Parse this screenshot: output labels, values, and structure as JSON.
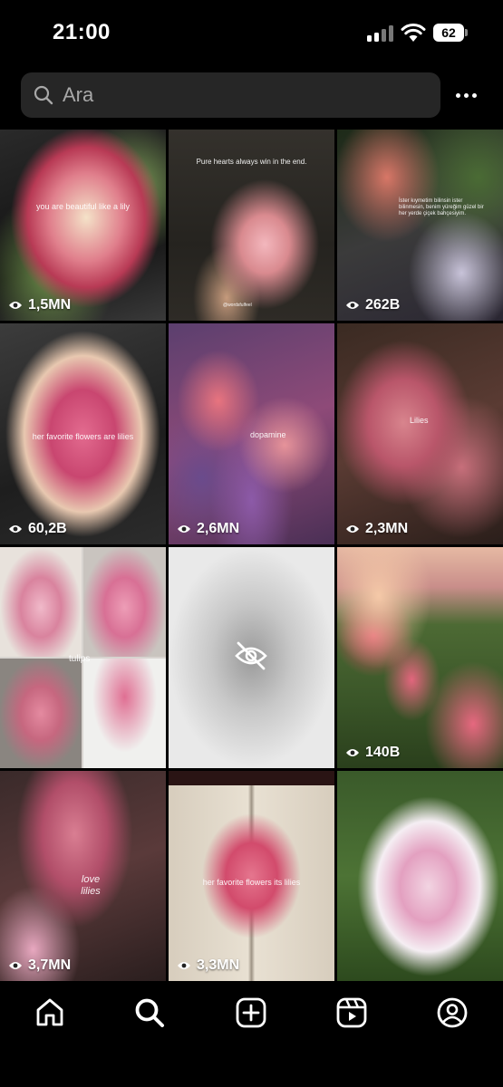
{
  "status_bar": {
    "time": "21:00",
    "battery": "62"
  },
  "search": {
    "placeholder": "Ara"
  },
  "tiles": [
    {
      "caption": "you are beautiful like a lily",
      "views": "1,5MN"
    },
    {
      "caption": "Pure hearts always win in the end.",
      "credit": "@wordsfulfeel",
      "views": ""
    },
    {
      "caption": "İster kıymetim bilinsin ister bilinmesin, benim yüreğim güzel bir her yerde çiçek bahçesiyim.",
      "views": "262B"
    },
    {
      "caption": "her favorite flowers are lilies",
      "views": "60,2B"
    },
    {
      "caption": "dopamine",
      "views": "2,6MN"
    },
    {
      "caption": "Lilies",
      "views": "2,3MN"
    },
    {
      "caption": "tulips",
      "views": ""
    },
    {
      "caption": "",
      "views": ""
    },
    {
      "caption": "",
      "views": "140B"
    },
    {
      "caption": "love lilies",
      "views": "3,7MN"
    },
    {
      "caption": "her favorite flowers its lilies",
      "views": "3,3MN"
    },
    {
      "caption": "",
      "views": ""
    }
  ],
  "icons": {
    "search": "search-icon",
    "more": "more-icon",
    "views": "eye-icon",
    "hidden": "eye-off-icon",
    "nav": [
      "home-icon",
      "explore-icon",
      "create-icon",
      "reels-icon",
      "profile-icon"
    ]
  },
  "colors": {
    "background": "#000000",
    "search_bg": "#262626",
    "placeholder": "#a8a8a8"
  }
}
